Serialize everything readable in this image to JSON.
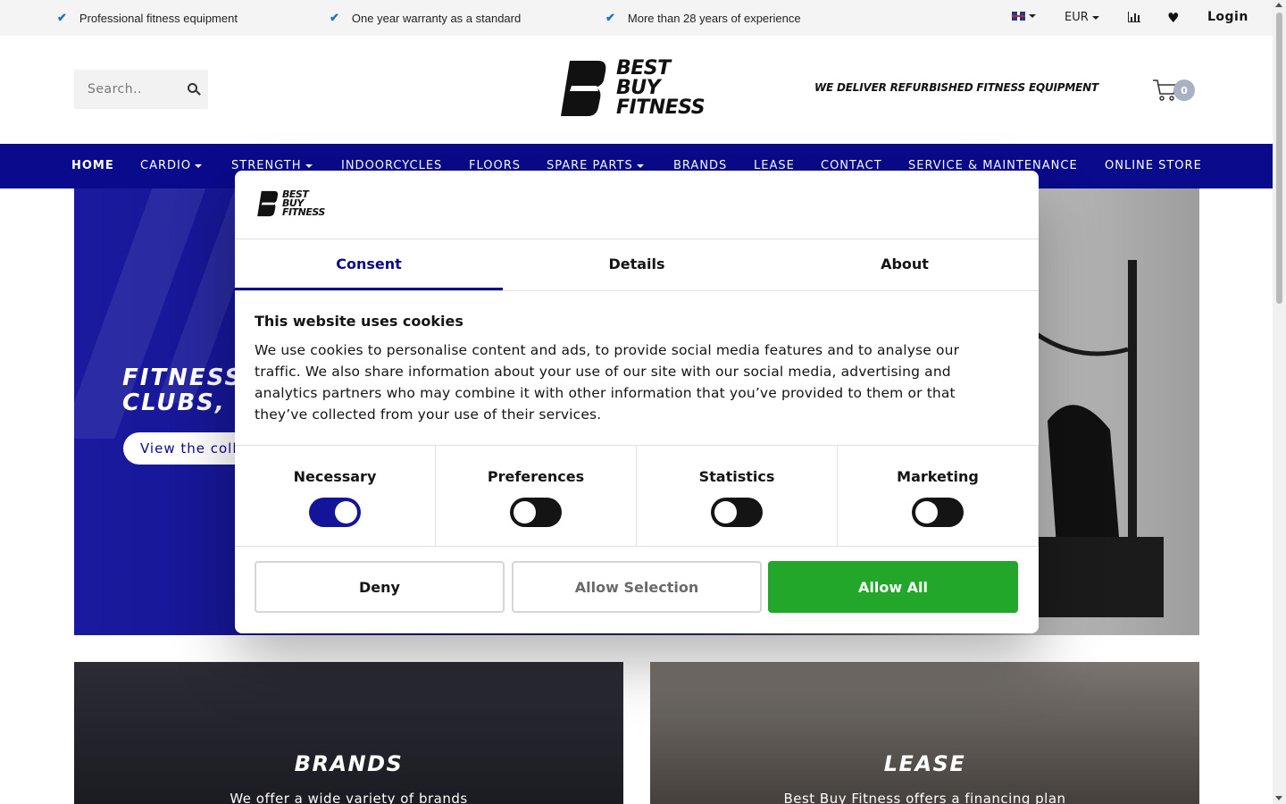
{
  "topbar": {
    "usps": [
      "Professional fitness equipment",
      "One year warranty as a standard",
      "More than 28 years of experience"
    ],
    "currency": "EUR",
    "login": "Login"
  },
  "header": {
    "search_placeholder": "Search..",
    "logo_lines": [
      "BEST",
      "BUY",
      "FITNESS"
    ],
    "tagline": "WE DELIVER REFURBISHED FITNESS EQUIPMENT",
    "cart_count": "0"
  },
  "nav": {
    "items": [
      "HOME",
      "CARDIO",
      "STRENGTH",
      "INDOORCYCLES",
      "FLOORS",
      "SPARE PARTS",
      "BRANDS",
      "LEASE",
      "CONTACT",
      "SERVICE & MAINTENANCE",
      "ONLINE STORE"
    ]
  },
  "hero": {
    "title_line1": "FITNESS",
    "title_line2": "CLUBS, C",
    "button": "View the colle"
  },
  "cards": [
    {
      "title": "BRANDS",
      "subtitle": "We offer a wide variety of brands"
    },
    {
      "title": "LEASE",
      "subtitle": "Best Buy Fitness offers a financing plan"
    }
  ],
  "cookie_dialog": {
    "logo_lines": [
      "BEST",
      "BUY",
      "FITNESS"
    ],
    "tabs": [
      "Consent",
      "Details",
      "About"
    ],
    "active_tab": "Consent",
    "heading": "This website uses cookies",
    "body": "We use cookies to personalise content and ads, to provide social media features and to analyse our traffic. We also share information about your use of our site with our social media, advertising and analytics partners who may combine it with other information that you’ve provided to them or that they’ve collected from your use of their services.",
    "toggles": [
      {
        "label": "Necessary",
        "on": true
      },
      {
        "label": "Preferences",
        "on": false
      },
      {
        "label": "Statistics",
        "on": false
      },
      {
        "label": "Marketing",
        "on": false
      }
    ],
    "buttons": {
      "deny": "Deny",
      "allow_selection": "Allow Selection",
      "allow_all": "Allow All"
    }
  },
  "colors": {
    "brand_navy": "#0a0a8c",
    "allow_green": "#22a72a",
    "check_blue": "#1a73c9"
  }
}
